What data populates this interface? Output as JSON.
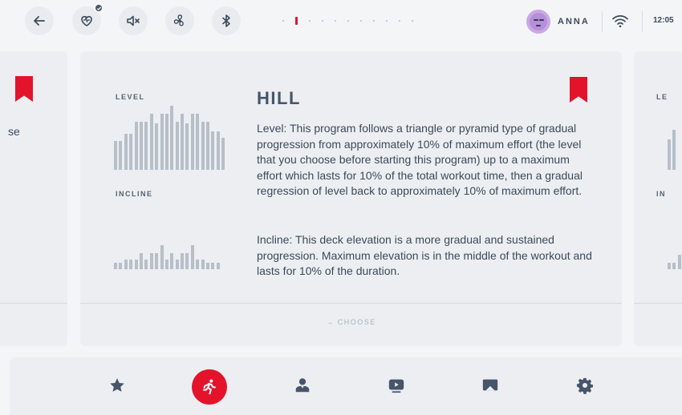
{
  "topbar": {
    "icons": [
      "back-arrow-icon",
      "heart-rate-icon",
      "mute-icon",
      "fan-icon",
      "bluetooth-icon"
    ],
    "page_indicator": {
      "total": 11,
      "active": 1
    },
    "user": {
      "name": "ANNA"
    },
    "time": "12:05"
  },
  "left_card": {
    "text_fragment": "se"
  },
  "right_card": {
    "level_fragment": "LE",
    "incline_fragment": "IN"
  },
  "main_card": {
    "level_label": "LEVEL",
    "incline_label": "INCLINE",
    "title": "HILL",
    "desc_level": "Level: This program follows a triangle or pyramid type of gradual progression from approximately 10% of maximum effort (the level that you choose before starting this program) up to a maximum effort which lasts for 10% of the total workout time, then a gradual regression of level back to approximately 10% of maximum effort.",
    "desc_incline": "Incline: This deck elevation is a more gradual and sustained progression. Maximum elevation is in the middle of the workout and lasts for 10% of the duration.",
    "choose_label": "→ CHOOSE",
    "level_profile": [
      36,
      36,
      45,
      45,
      60,
      60,
      60,
      70,
      58,
      70,
      70,
      80,
      60,
      70,
      58,
      70,
      70,
      60,
      60,
      48,
      48,
      40
    ],
    "incline_profile": [
      8,
      8,
      12,
      12,
      12,
      20,
      12,
      20,
      20,
      30,
      12,
      20,
      12,
      20,
      20,
      30,
      12,
      12,
      8,
      8,
      8
    ]
  },
  "bottomnav": {
    "items": [
      "star-icon",
      "runner-icon",
      "profile-icon",
      "video-icon",
      "scenery-icon",
      "gear-icon"
    ],
    "active": "runner-icon",
    "accent": "#e3132c"
  }
}
